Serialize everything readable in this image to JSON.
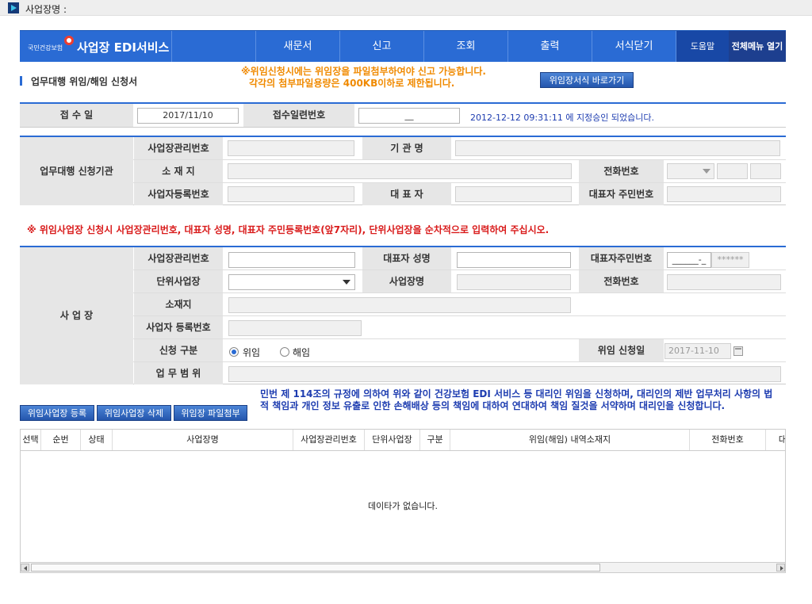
{
  "window": {
    "title": "사업장명 :"
  },
  "navbar": {
    "logo_org": "국민건강보험",
    "logo_text": "사업장 EDI서비스",
    "items": [
      "새문서",
      "신고",
      "조회",
      "출력",
      "서식닫기"
    ],
    "help": "도움말",
    "all_menu": "전체메뉴 열기",
    "colors": {
      "primary": "#2a6bd4",
      "help_bg": "#1848a6",
      "all_bg": "#1d3f8f"
    }
  },
  "page": {
    "title": "업무대행 위임/해임 신청서",
    "notice_line1": "※위임신청시에는 위임장을 파일첨부하여야 신고 가능합니다.",
    "notice_line2": "각각의 첨부파일용량은 400KB이하로 제한됩니다.",
    "link_button": "위임장서식 바로가기"
  },
  "receipt": {
    "date_label": "접 수 일",
    "date_value": "2017/11/10",
    "serial_label": "접수일련번호",
    "serial_value": "__",
    "status_text": "2012-12-12 09:31:11 에 지정승인 되었습니다."
  },
  "agency": {
    "section_label": "업무대행 신청기관",
    "mgmt_no_label": "사업장관리번호",
    "org_name_label": "기 관 명",
    "location_label": "소 재 지",
    "phone_label": "전화번호",
    "biz_reg_label": "사업자등록번호",
    "rep_label": "대 표 자",
    "rep_id_label": "대표자 주민번호"
  },
  "warning": "※ 위임사업장 신청시 사업장관리번호, 대표자 성명, 대표자 주민등록번호(앞7자리), 단위사업장을 순차적으로 입력하여 주십시오.",
  "workplace": {
    "section_label": "사 업 장",
    "mgmt_no_label": "사업장관리번호",
    "rep_name_label": "대표자 성명",
    "rep_id_label": "대표자주민번호",
    "rep_id_value": "______-_",
    "rep_id_mask": "******",
    "unit_label": "단위사업장",
    "name_label": "사업장명",
    "phone_label": "전화번호",
    "location_label": "소재지",
    "biz_reg_label": "사업자 등록번호",
    "type_label": "신청 구분",
    "option_delegate": "위임",
    "option_dismiss": "해임",
    "apply_date_label": "위임 신청일",
    "apply_date_value": "2017-11-10",
    "scope_label": "업 무 범 위"
  },
  "actions": {
    "register": "위임사업장 등록",
    "delete": "위임사업장 삭제",
    "attach": "위임장 파일첨부"
  },
  "declaration": "민번 제 114조의 규정에 의하여 위와 같이 건강보험 EDI 서비스 등 대리인 위임을 신청하며, 대리인의 제반 업무처리 사항의 법적 책임과 개인 정보 유출로 인한 손해배상 등의 책임에 대하여 연대하여 책임 질것을 서약하며 대리인을 신청합니다.",
  "table": {
    "columns": [
      "선택",
      "순번",
      "상태",
      "사업장명",
      "사업장관리번호",
      "단위사업장",
      "구분",
      "위임(해임) 내역소재지",
      "전화번호",
      "대"
    ],
    "empty_message": "데이타가 없습니다."
  }
}
